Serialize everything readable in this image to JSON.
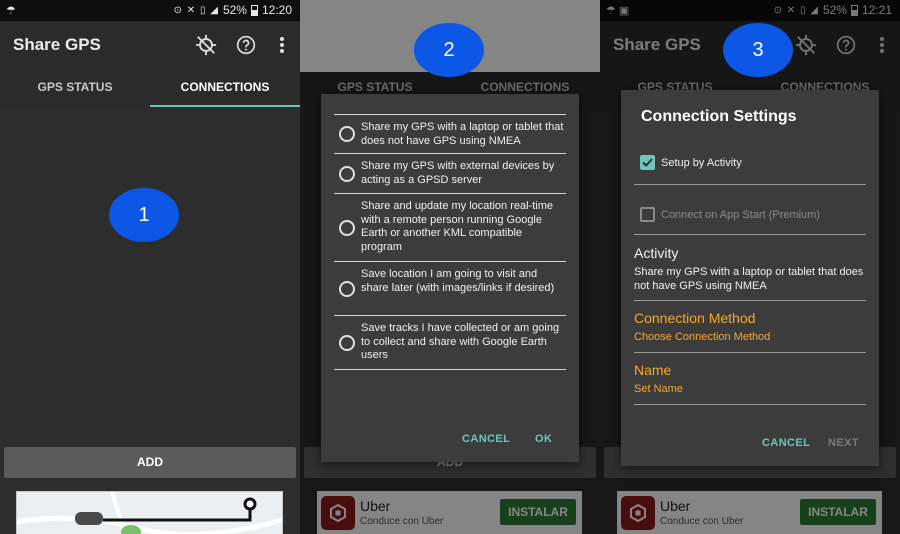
{
  "screens": [
    {
      "status": {
        "time": "12:20",
        "battery": "52%"
      },
      "app_title": "Share GPS",
      "tabs": [
        {
          "label": "GPS STATUS",
          "active": false
        },
        {
          "label": "CONNECTIONS",
          "active": true
        }
      ],
      "marker": "1",
      "add_label": "ADD",
      "actions": [
        "gps-off-icon",
        "help-icon",
        "overflow-menu-icon"
      ]
    },
    {
      "marker": "2",
      "tabs": [
        {
          "label": "GPS STATUS"
        },
        {
          "label": "CONNECTIONS"
        }
      ],
      "add_label": "ADD",
      "dialog": {
        "options": [
          "Share my GPS with a laptop or tablet that does not have GPS using NMEA",
          "Share my GPS with external devices by acting as a GPSD server",
          "Share and update my location real-time with a remote person running Google Earth or another KML compatible program",
          "Save location I am going to visit and share later (with images/links if desired)",
          "Save tracks I have collected or am going to collect and share with Google Earth users"
        ],
        "cancel": "CANCEL",
        "ok": "OK"
      },
      "ad": {
        "name": "Uber",
        "subtitle": "Conduce con Uber",
        "cta": "INSTALAR"
      }
    },
    {
      "status": {
        "time": "12:21",
        "battery": "52%"
      },
      "app_title": "Share GPS",
      "marker": "3",
      "tabs": [
        {
          "label": "GPS STATUS"
        },
        {
          "label": "CONNECTIONS"
        }
      ],
      "add_label": "ADD",
      "dialog": {
        "title": "Connection Settings",
        "setup_by_activity": {
          "label": "Setup by Activity",
          "checked": true
        },
        "connect_on_start": {
          "label": "Connect on App Start (Premium)",
          "checked": false
        },
        "activity": {
          "title": "Activity",
          "summary": "Share my GPS with a laptop or tablet that does not have GPS using NMEA"
        },
        "connection_method": {
          "title": "Connection Method",
          "summary": "Choose Connection Method"
        },
        "name": {
          "title": "Name",
          "summary": "Set Name"
        },
        "cancel": "CANCEL",
        "next": "NEXT"
      },
      "ad": {
        "name": "Uber",
        "subtitle": "Conduce con Uber",
        "cta": "INSTALAR"
      }
    }
  ],
  "colors": {
    "accent": "#6bc7bd",
    "highlight": "#f9a825",
    "marker": "#0d57e6",
    "background": "#2d2d2d",
    "dialog": "#3c3c3c",
    "ad_button": "#2f7d35",
    "ad_logo": "#8f1a1a"
  }
}
